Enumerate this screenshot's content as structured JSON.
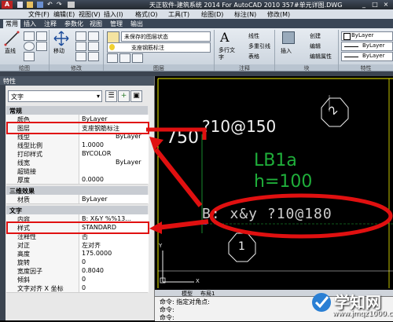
{
  "window": {
    "title": "天正软件-建筑系统 2014  For AutoCAD 2010      357#单元详图.DWG",
    "logo": "A",
    "controls": [
      "_",
      "□",
      "×"
    ]
  },
  "menu": [
    "文件(F)",
    "编辑(E)",
    "视图(V)",
    "插入(I)",
    "格式(O)",
    "工具(T)",
    "绘图(D)",
    "标注(N)",
    "修改(M)"
  ],
  "ribbon_tabs": [
    "常用",
    "插入",
    "注释",
    "参数化",
    "视图",
    "管理",
    "输出"
  ],
  "ribbon": {
    "groups": [
      "绘图",
      "修改",
      "图层",
      "注释",
      "块",
      "特性"
    ],
    "draw_tools": [
      "直线"
    ],
    "modify_tools": [
      "移动"
    ],
    "layer_combo": "未保存的图层状态",
    "layer_current": "支座钢筋标注",
    "annotation": {
      "multiline_text": "多行文字",
      "items": [
        "线性",
        "多重引线",
        "表格"
      ]
    },
    "block": {
      "insert": "插入",
      "items": [
        "创建",
        "编辑",
        "编辑属性"
      ]
    },
    "properties": {
      "color": "ByLayer",
      "linetype": "ByLayer",
      "lineweight": "ByLayer"
    }
  },
  "palette": {
    "title": "特性",
    "selection": "文字",
    "sections": [
      {
        "name": "常规",
        "rows": [
          {
            "key": "颜色",
            "value": "ByLayer"
          },
          {
            "key": "图层",
            "value": "支座钢筋标注"
          },
          {
            "key": "线型",
            "value": "ByLayer"
          },
          {
            "key": "线型比例",
            "value": "1.0000"
          },
          {
            "key": "打印样式",
            "value": "BYCOLOR"
          },
          {
            "key": "线宽",
            "value": "ByLayer"
          },
          {
            "key": "超链接",
            "value": ""
          },
          {
            "key": "厚度",
            "value": "0.0000"
          }
        ]
      },
      {
        "name": "三维效果",
        "rows": [
          {
            "key": "材质",
            "value": "ByLayer"
          }
        ]
      },
      {
        "name": "文字",
        "rows": [
          {
            "key": "内容",
            "value": "B: X&Y %%13..."
          },
          {
            "key": "样式",
            "value": "STANDARD"
          },
          {
            "key": "注释性",
            "value": "否"
          },
          {
            "key": "对正",
            "value": "左对齐"
          },
          {
            "key": "高度",
            "value": "175.0000"
          },
          {
            "key": "旋转",
            "value": "0"
          },
          {
            "key": "宽度因子",
            "value": "0.8040"
          },
          {
            "key": "倾斜",
            "value": "0"
          },
          {
            "key": "文字对齐 X 坐标",
            "value": "0"
          }
        ]
      }
    ]
  },
  "drawing": {
    "texts": {
      "dim": "750",
      "rebar_top": "?10@150",
      "slab_id": "LB1a",
      "thickness": "h=100",
      "rebar_bottom": "B: x&y ?10@180",
      "axis_top": "2",
      "axis_bottom": "1"
    },
    "ucs": {
      "x": "X",
      "y": "Y"
    }
  },
  "layout_tabs": [
    "模型",
    "布局1"
  ],
  "command_lines": [
    "命令: 指定对角点:",
    "命令:",
    "命令:"
  ],
  "watermark": {
    "brand": "学知网",
    "url": "www.jmqz1000.com"
  },
  "colors": {
    "annotation": "#e01010",
    "cad_green": "#1fae3a",
    "cad_yellow": "#f2f200",
    "cad_white": "#f0f0f0"
  }
}
